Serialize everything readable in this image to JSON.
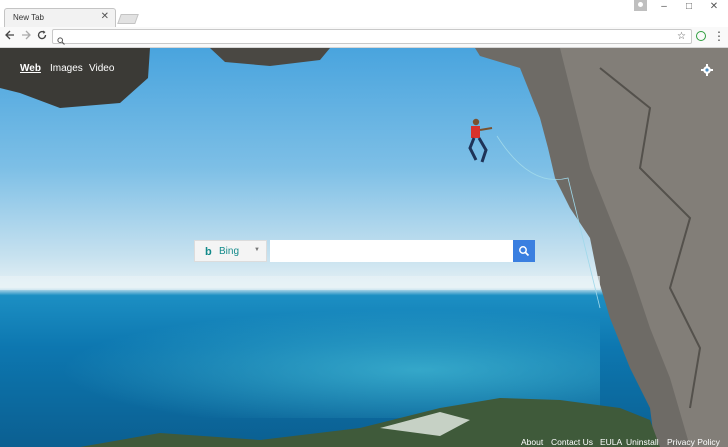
{
  "browser": {
    "tab_title": "New Tab",
    "tab_close": "✕",
    "window_controls": {
      "minimize": "–",
      "maximize": "□",
      "close": "✕"
    },
    "omnibox_value": "",
    "icons": [
      "back-icon",
      "forward-icon",
      "reload-icon",
      "search-icon",
      "star-icon",
      "extension-icon",
      "menu-icon",
      "profile-icon"
    ]
  },
  "page": {
    "nav": [
      {
        "label": "Web",
        "active": true
      },
      {
        "label": "Images",
        "active": false
      },
      {
        "label": "Video",
        "active": false
      }
    ],
    "search": {
      "provider_label": "Bing",
      "provider_logo": "b",
      "placeholder": ""
    },
    "footer": {
      "about": "About",
      "contact": "Contact Us",
      "eula": "EULA",
      "uninstall": "Uninstall",
      "privacy": "Privacy Policy"
    }
  },
  "colors": {
    "search_button": "#3a7fe0",
    "bing_teal": "#138a8a"
  }
}
